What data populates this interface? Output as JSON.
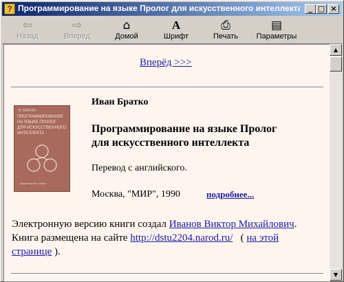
{
  "window": {
    "title": "Программирование на языке Пролог  для искусственного интеллекта",
    "minimize_glyph": "_",
    "maximize_glyph": "□",
    "close_glyph": "×"
  },
  "toolbar": {
    "items": [
      {
        "label": "Назад",
        "icon": "back-arrow-icon",
        "enabled": false
      },
      {
        "label": "Вперед",
        "icon": "forward-arrow-icon",
        "enabled": false
      },
      {
        "label": "Домой",
        "icon": "home-icon",
        "enabled": true
      },
      {
        "label": "Шрифт",
        "icon": "font-icon",
        "enabled": true
      },
      {
        "label": "Печать",
        "icon": "print-icon",
        "enabled": true
      },
      {
        "label": "Параметры",
        "icon": "options-icon",
        "enabled": true
      }
    ]
  },
  "page": {
    "forward_link": "Вперёд >>>",
    "author": "Иван Братко",
    "book_title_line1": "Программирование на языке Пролог",
    "book_title_line2": "для искусственного интеллекта",
    "translation_note": "Перевод с английского.",
    "publisher": "Москва, \"МИР\", 1990",
    "more_link": "подробнее...",
    "ebook_text": "Электронную версию книги создал",
    "creator_link": "Иванов Виктор Михайлович",
    "ebook_end": ".",
    "hosted_text": "Книга размещена на сайте",
    "site_link": "http://dstu2204.narod.ru/",
    "paren_open": "(",
    "this_page_link_1": "на этой",
    "this_page_link_2": "странице",
    "paren_close": ")."
  },
  "cover": {
    "author": "И. БРАТКО",
    "title_lines": [
      "ПРОГРАММИРОВАНИЕ",
      "НА ЯЗЫКЕ ПРОЛОГ",
      "ДЛЯ ИСКУССТВЕННОГО",
      "ИНТЕЛЛЕКТА"
    ],
    "publisher": "Издательство «Мир»"
  },
  "colors": {
    "page_bg": "#fff5ee",
    "link": "#1a1aa6",
    "titlebar_start": "#0a246a",
    "titlebar_end": "#a6caf0",
    "cover": "#a86a5c"
  }
}
